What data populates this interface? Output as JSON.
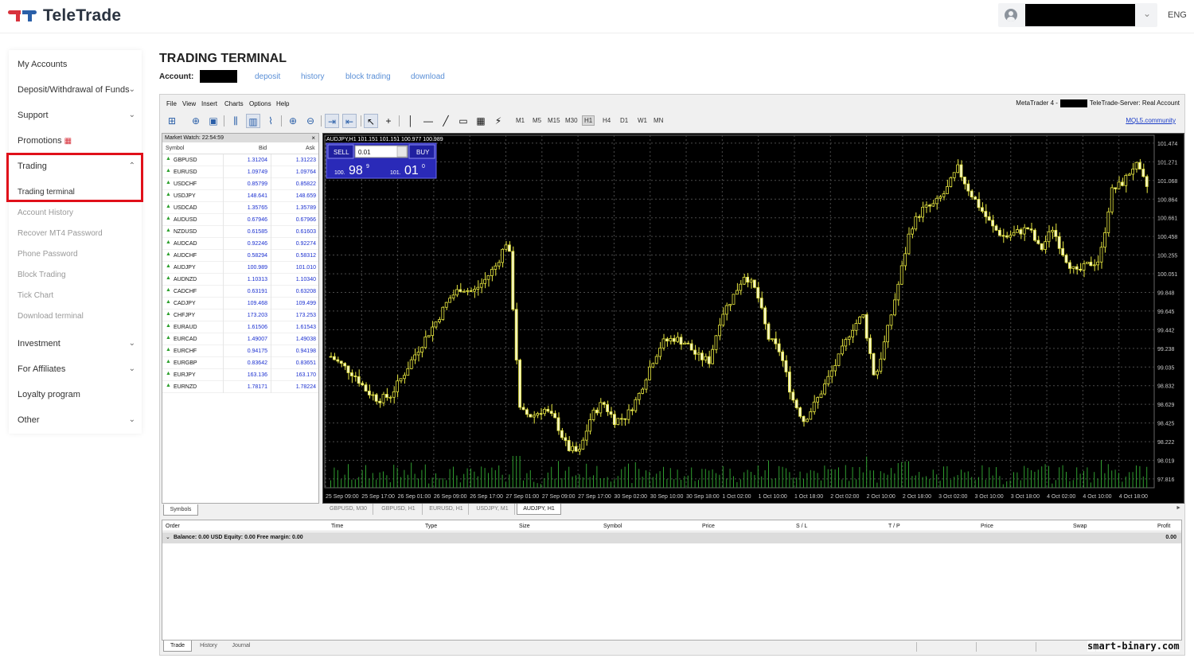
{
  "header": {
    "brand": "TeleTrade",
    "lang": "ENG"
  },
  "sidebar": {
    "items": [
      {
        "label": "My Accounts"
      },
      {
        "label": "Deposit/Withdrawal of Funds"
      },
      {
        "label": "Support"
      },
      {
        "label": "Promotions"
      },
      {
        "label": "Trading"
      },
      {
        "label": "Investment"
      },
      {
        "label": "For Affiliates"
      },
      {
        "label": "Loyalty program"
      },
      {
        "label": "Other"
      }
    ],
    "trading_sub": [
      {
        "label": "Trading terminal"
      },
      {
        "label": "Account History"
      },
      {
        "label": "Recover MT4 Password"
      },
      {
        "label": "Phone Password"
      },
      {
        "label": "Block Trading"
      },
      {
        "label": "Tick Chart"
      },
      {
        "label": "Download terminal"
      }
    ]
  },
  "page": {
    "title": "TRADING TERMINAL",
    "account_label": "Account:",
    "links": [
      "deposit",
      "history",
      "block trading",
      "download"
    ]
  },
  "terminal": {
    "menu": [
      "File",
      "View",
      "Insert",
      "Charts",
      "Options",
      "Help"
    ],
    "server_prefix": "MetaTrader 4 -",
    "server_suffix": "TeleTrade-Server: Real Account",
    "timeframes": [
      "M1",
      "M5",
      "M15",
      "M30",
      "H1",
      "H4",
      "D1",
      "W1",
      "MN"
    ],
    "active_timeframe": "H1",
    "mql_link": "MQL5.community",
    "market_watch": {
      "title": "Market Watch: 22:54:59",
      "close": "×",
      "col_symbol": "Symbol",
      "col_bid": "Bid",
      "col_ask": "Ask",
      "rows": [
        {
          "symbol": "GBPUSD",
          "bid": "1.31204",
          "ask": "1.31223"
        },
        {
          "symbol": "EURUSD",
          "bid": "1.09749",
          "ask": "1.09764"
        },
        {
          "symbol": "USDCHF",
          "bid": "0.85799",
          "ask": "0.85822"
        },
        {
          "symbol": "USDJPY",
          "bid": "148.641",
          "ask": "148.659"
        },
        {
          "symbol": "USDCAD",
          "bid": "1.35765",
          "ask": "1.35789"
        },
        {
          "symbol": "AUDUSD",
          "bid": "0.67946",
          "ask": "0.67966"
        },
        {
          "symbol": "NZDUSD",
          "bid": "0.61585",
          "ask": "0.61603"
        },
        {
          "symbol": "AUDCAD",
          "bid": "0.92246",
          "ask": "0.92274"
        },
        {
          "symbol": "AUDCHF",
          "bid": "0.58294",
          "ask": "0.58312"
        },
        {
          "symbol": "AUDJPY",
          "bid": "100.989",
          "ask": "101.010"
        },
        {
          "symbol": "AUDNZD",
          "bid": "1.10313",
          "ask": "1.10340"
        },
        {
          "symbol": "CADCHF",
          "bid": "0.63191",
          "ask": "0.63208"
        },
        {
          "symbol": "CADJPY",
          "bid": "109.468",
          "ask": "109.499"
        },
        {
          "symbol": "CHFJPY",
          "bid": "173.203",
          "ask": "173.253"
        },
        {
          "symbol": "EURAUD",
          "bid": "1.61506",
          "ask": "1.61543"
        },
        {
          "symbol": "EURCAD",
          "bid": "1.49007",
          "ask": "1.49038"
        },
        {
          "symbol": "EURCHF",
          "bid": "0.94175",
          "ask": "0.94198"
        },
        {
          "symbol": "EURGBP",
          "bid": "0.83642",
          "ask": "0.83651"
        },
        {
          "symbol": "EURJPY",
          "bid": "163.136",
          "ask": "163.170"
        },
        {
          "symbol": "EURNZD",
          "bid": "1.78171",
          "ask": "1.78224"
        }
      ],
      "tab": "Symbols"
    },
    "chart": {
      "header": "AUDJPY,H1  101.151 101.151 100.977 100.989",
      "sell_label": "SELL",
      "buy_label": "BUY",
      "lot": "0.01",
      "sell_small": "100.",
      "sell_big": "98",
      "sell_sup": "9",
      "buy_small": "101.",
      "buy_big": "01",
      "buy_sup": "0",
      "tabs": [
        "GBPUSD, M30",
        "GBPUSD, H1",
        "EURUSD, H1",
        "USDJPY, M1",
        "AUDJPY, H1"
      ],
      "tab_arrow": "►"
    },
    "trade": {
      "columns": [
        "Order",
        "Time",
        "Type",
        "Size",
        "Symbol",
        "Price",
        "S / L",
        "T / P",
        "Price",
        "Swap",
        "Profit"
      ],
      "balance": "Balance: 0.00 USD  Equity: 0.00  Free margin: 0.00",
      "profit": "0.00",
      "tabs": [
        "Trade",
        "History",
        "Journal"
      ]
    }
  },
  "chart_data": {
    "type": "candlestick",
    "symbol": "AUDJPY,H1",
    "y_ticks": [
      "101.474",
      "101.271",
      "101.068",
      "100.864",
      "100.661",
      "100.458",
      "100.255",
      "100.051",
      "99.848",
      "99.645",
      "99.442",
      "99.238",
      "99.035",
      "98.832",
      "98.629",
      "98.425",
      "98.222",
      "98.019",
      "97.816"
    ],
    "ylim": [
      97.72,
      101.56
    ],
    "x_ticks": [
      "25 Sep 09:00",
      "25 Sep 17:00",
      "26 Sep 01:00",
      "26 Sep 09:00",
      "26 Sep 17:00",
      "27 Sep 01:00",
      "27 Sep 09:00",
      "27 Sep 17:00",
      "30 Sep 02:00",
      "30 Sep 10:00",
      "30 Sep 18:00",
      "1 Oct 02:00",
      "1 Oct 10:00",
      "1 Oct 18:00",
      "2 Oct 02:00",
      "2 Oct 10:00",
      "2 Oct 18:00",
      "3 Oct 02:00",
      "3 Oct 10:00",
      "3 Oct 18:00",
      "4 Oct 02:00",
      "4 Oct 10:00",
      "4 Oct 18:00"
    ],
    "close_path": [
      99.15,
      99.05,
      98.95,
      98.78,
      98.68,
      98.72,
      98.92,
      99.15,
      99.35,
      99.55,
      99.78,
      99.9,
      99.85,
      99.98,
      100.15,
      100.45,
      98.55,
      98.5,
      98.58,
      98.45,
      98.15,
      98.1,
      98.5,
      98.65,
      98.45,
      98.5,
      98.72,
      99.05,
      99.3,
      99.35,
      99.3,
      99.15,
      99.1,
      99.6,
      99.8,
      100.05,
      99.85,
      99.35,
      99.2,
      98.7,
      98.45,
      98.65,
      98.9,
      99.15,
      99.45,
      99.6,
      98.9,
      99.4,
      99.95,
      100.55,
      100.75,
      100.8,
      100.95,
      101.2,
      100.95,
      100.75,
      100.55,
      100.45,
      100.5,
      100.55,
      100.3,
      100.55,
      100.25,
      100.05,
      100.15,
      100.2,
      100.95,
      101.05,
      101.25,
      101.0
    ],
    "volume_panel": true,
    "grid": true
  }
}
